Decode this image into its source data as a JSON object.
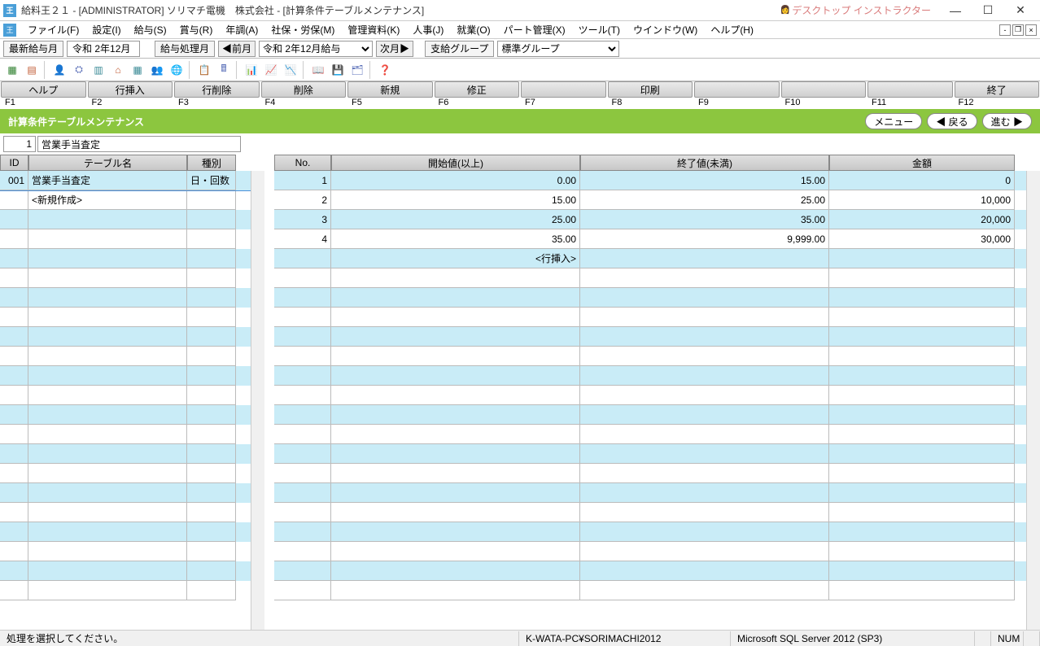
{
  "title": "給料王２１ - [ADMINISTRATOR] ソリマチ電機　株式会社 - [計算条件テーブルメンテナンス]",
  "instructor_label": "デスクトップ\nインストラクター",
  "menus": [
    "ファイル(F)",
    "設定(I)",
    "給与(S)",
    "賞与(R)",
    "年調(A)",
    "社保・労保(M)",
    "管理資料(K)",
    "人事(J)",
    "就業(O)",
    "パート管理(X)",
    "ツール(T)",
    "ウインドウ(W)",
    "ヘルプ(H)"
  ],
  "filter": {
    "latest_label": "最新給与月",
    "latest_value": "令和 2年12月",
    "proc_label": "給与処理月",
    "prev": "◀前月",
    "selected": "令和 2年12月給与",
    "next": "次月▶",
    "group_label": "支給グループ",
    "group_value": "標準グループ"
  },
  "fnbuttons": [
    "ヘルプ",
    "行挿入",
    "行削除",
    "削除",
    "新規",
    "修正",
    "",
    "印刷",
    "",
    "",
    "",
    "終了"
  ],
  "fnlabels": [
    "F1",
    "F2",
    "F3",
    "F4",
    "F5",
    "F6",
    "F7",
    "F8",
    "F9",
    "F10",
    "F11",
    "F12"
  ],
  "green_title": "計算条件テーブルメンテナンス",
  "green_btns": {
    "menu": "メニュー",
    "back": "◀ 戻る",
    "forward": "進む ▶"
  },
  "subheader": {
    "num": "1",
    "name": "営業手当査定"
  },
  "left_headers": {
    "id": "ID",
    "name": "テーブル名",
    "type": "種別"
  },
  "left_rows": [
    {
      "id": "001",
      "name": "営業手当査定",
      "type": "日・回数",
      "selected": true
    },
    {
      "id": "",
      "name": "<新規作成>",
      "type": "",
      "selected": false
    }
  ],
  "right_headers": {
    "no": "No.",
    "start": "開始値(以上)",
    "end": "終了値(未満)",
    "amount": "金額"
  },
  "right_rows": [
    {
      "no": "1",
      "start": "0.00",
      "end": "15.00",
      "amount": "0"
    },
    {
      "no": "2",
      "start": "15.00",
      "end": "25.00",
      "amount": "10,000"
    },
    {
      "no": "3",
      "start": "25.00",
      "end": "35.00",
      "amount": "20,000"
    },
    {
      "no": "4",
      "start": "35.00",
      "end": "9,999.00",
      "amount": "30,000"
    }
  ],
  "right_insert_row": "<行挿入>",
  "status": {
    "msg": "処理を選択してください。",
    "host": "K-WATA-PC¥SORIMACHI2012",
    "db": "Microsoft SQL Server 2012 (SP3)",
    "num": "NUM"
  }
}
